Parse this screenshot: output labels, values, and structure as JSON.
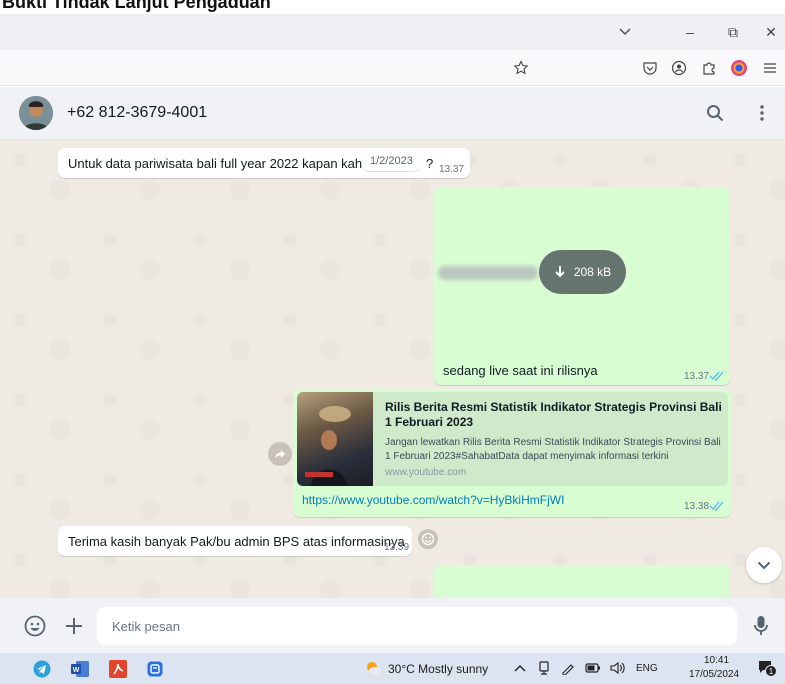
{
  "caption": {
    "title": "Bukti Tindak Lanjut Pengaduan"
  },
  "window_controls": {
    "dropdown": "⌵",
    "minimize": "–",
    "restore": "⧉",
    "close": "✕"
  },
  "contact": {
    "name": "+62 812-3679-4001"
  },
  "messages": {
    "question": {
      "text": "Untuk data pariwisata bali full year 2022 kapan kah aka",
      "tail": "?",
      "time": "13.37"
    },
    "date_separator": "1/2/2023",
    "file": {
      "size": "208 kB",
      "caption": "sedang live saat ini rilisnya",
      "time": "13.37"
    },
    "link": {
      "title": "Rilis Berita Resmi Statistik Indikator Strategis Provinsi Bali 1 Februari 2023",
      "description": "Jangan lewatkan Rilis Berita Resmi Statistik Indikator Strategis Provinsi Bali 1 Februari 2023#SahabatData dapat menyimak informasi terkini",
      "site": "www.youtube.com",
      "url": "https://www.youtube.com/watch?v=HyBkiHmFjWI",
      "time": "13.38"
    },
    "thanks": {
      "text": "Terima kasih banyak Pak/bu admin BPS atas informasinya",
      "time": "13.39"
    }
  },
  "composer": {
    "placeholder": "Ketik pesan"
  },
  "taskbar": {
    "weather": "30°C  Mostly sunny",
    "language": "ENG",
    "time": "10:41",
    "date": "17/05/2024",
    "notification_count": "1"
  },
  "colors": {
    "outgoing_bubble": "#d9fdd3",
    "incoming_bubble": "#ffffff",
    "link": "#027eb5",
    "read_tick": "#53bdeb"
  }
}
